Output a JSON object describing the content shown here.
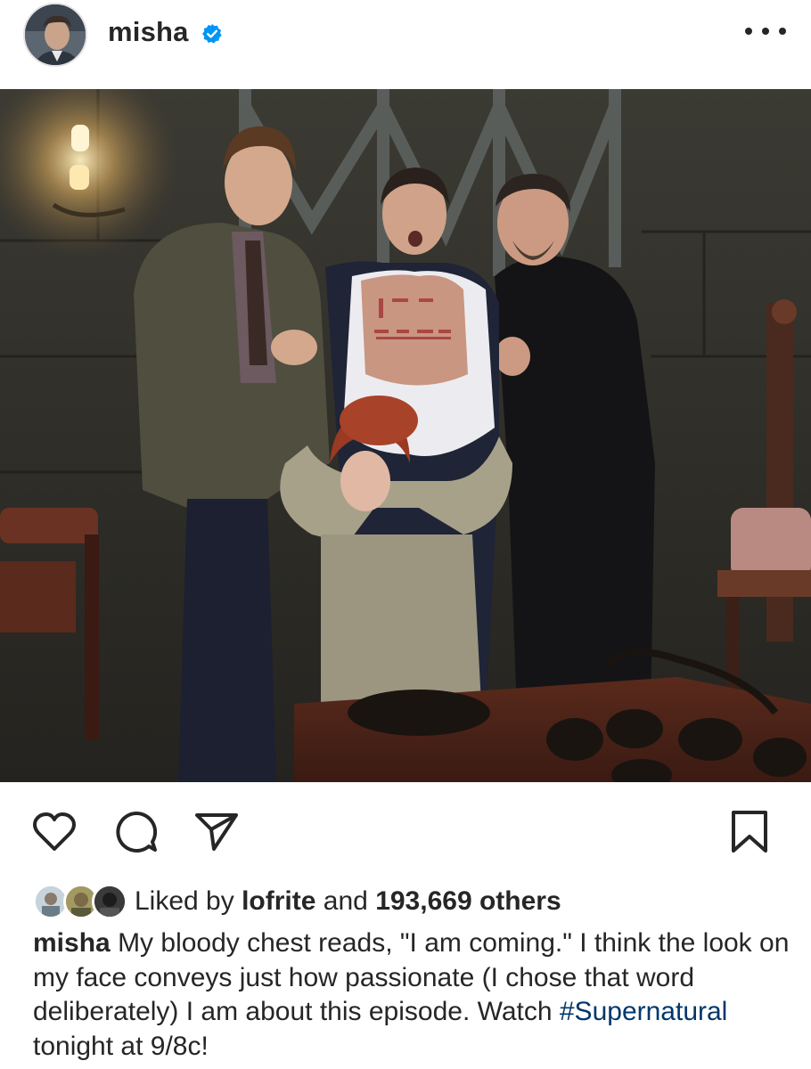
{
  "post": {
    "username": "misha",
    "verified": true,
    "more_icon": "more-horizontal-icon"
  },
  "photo": {
    "chest_writing": "I AM COMING"
  },
  "actions": {
    "like_icon": "heart-outline-icon",
    "comment_icon": "comment-bubble-icon",
    "share_icon": "paper-plane-icon",
    "save_icon": "bookmark-outline-icon"
  },
  "likes": {
    "prefix": "Liked by",
    "first_user": "lofrite",
    "connector": "and",
    "count_text": "193,669 others"
  },
  "caption": {
    "username": "misha",
    "text_before": "My bloody chest reads, \"I am coming.\" I think the look on my face conveys just how passionate (I chose that word deliberately) I am about this episode. Watch",
    "hashtag": "#Supernatural",
    "text_after": "tonight at 9/8c!"
  },
  "colors": {
    "text": "#262626",
    "verified_blue": "#0095f6",
    "hashtag": "#00376b"
  }
}
